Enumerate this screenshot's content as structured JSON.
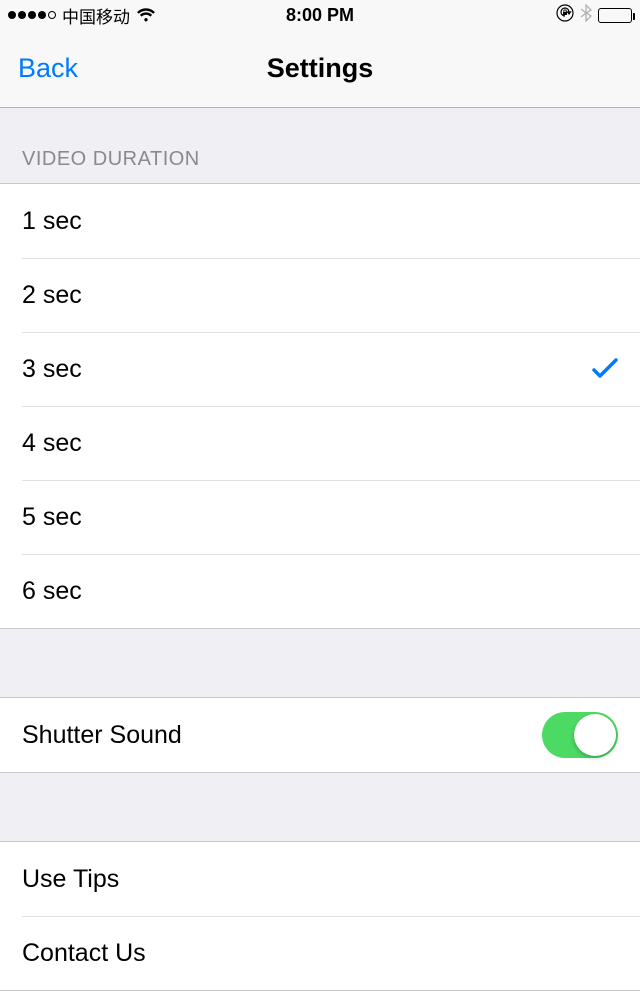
{
  "status": {
    "carrier": "中国移动",
    "time": "8:00 PM"
  },
  "nav": {
    "back": "Back",
    "title": "Settings"
  },
  "sections": {
    "video_duration_header": "VIDEO DURATION",
    "duration_options": {
      "opt1": "1 sec",
      "opt2": "2 sec",
      "opt3": "3 sec",
      "opt4": "4 sec",
      "opt5": "5 sec",
      "opt6": "6 sec"
    },
    "selected_duration": "3 sec",
    "shutter_sound_label": "Shutter Sound",
    "shutter_sound_on": true,
    "use_tips_label": "Use Tips",
    "contact_us_label": "Contact Us"
  }
}
